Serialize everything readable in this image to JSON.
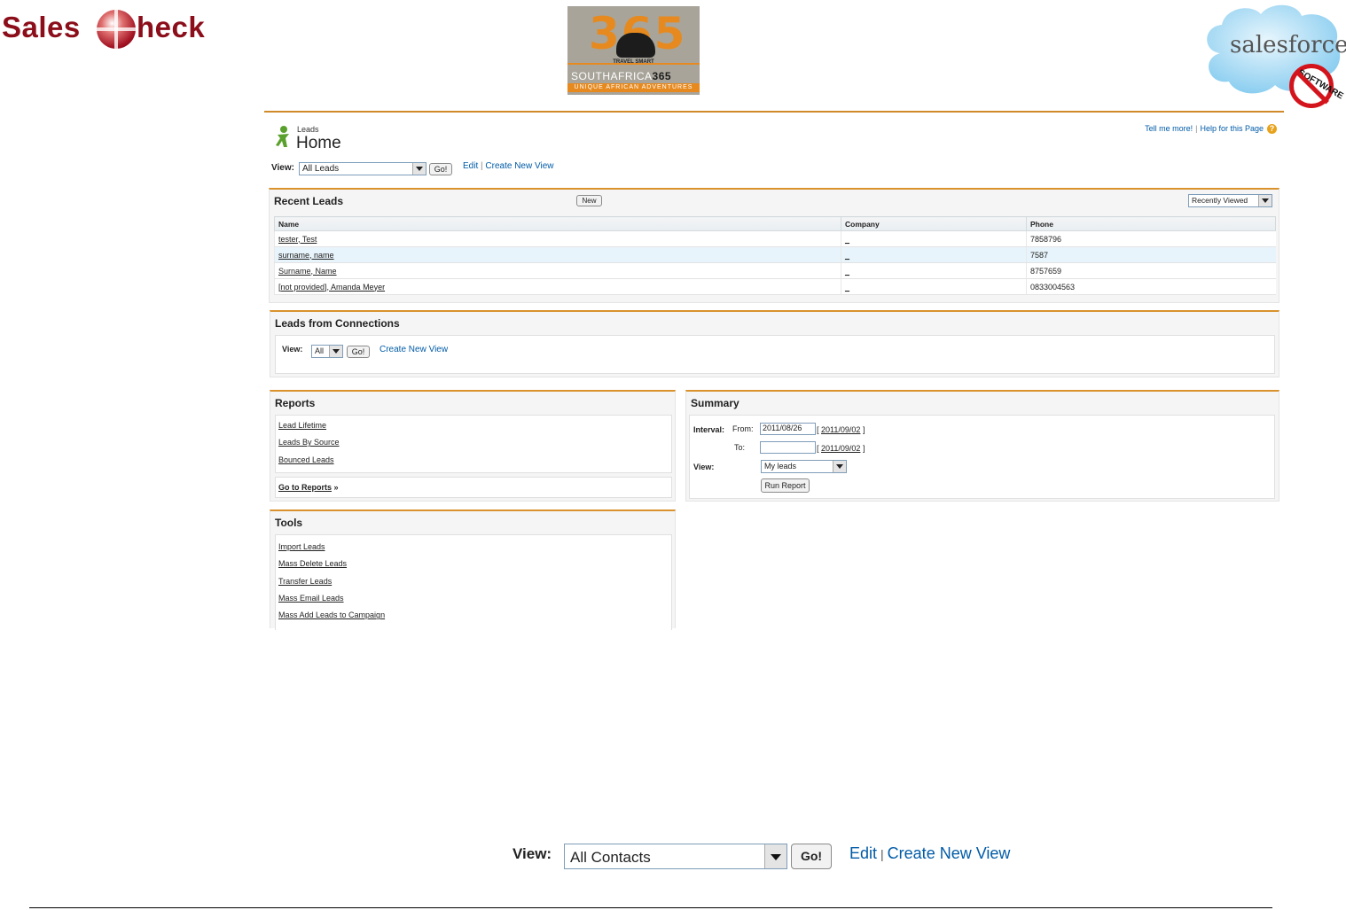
{
  "header": {
    "brand_left": {
      "text_before": "Sales",
      "text_after": "heck"
    },
    "brand_center": {
      "number": "365",
      "travel_smart": "TRAVEL SMART",
      "name_a": "SOUTHAFRICA",
      "name_b": "365",
      "tagline": "UNIQUE AFRICAN ADVENTURES"
    },
    "brand_right": {
      "word": "salesforce",
      "badge": "SOFTWARE"
    }
  },
  "page": {
    "object_label": "Leads",
    "title": "Home",
    "tell_me_more": "Tell me more!",
    "help_link": "Help for this Page",
    "help_icon": "?",
    "view_label": "View:",
    "view_selected": "All Leads",
    "go": "Go!",
    "edit": "Edit",
    "sep": "|",
    "create_new_view": "Create New View"
  },
  "recent_leads": {
    "title": "Recent Leads",
    "new_button": "New",
    "filter_selected": "Recently Viewed",
    "columns": [
      "Name",
      "Company",
      "Phone"
    ],
    "rows": [
      {
        "name": "tester, Test",
        "company": "_",
        "phone": "7858796"
      },
      {
        "name": "surname, name",
        "company": "_",
        "phone": "7587"
      },
      {
        "name": "Surname, Name",
        "company": "_",
        "phone": "8757659"
      },
      {
        "name": "[not provided], Amanda Meyer",
        "company": "_",
        "phone": "0833004563"
      }
    ]
  },
  "connections": {
    "title": "Leads from Connections",
    "view_label": "View:",
    "view_selected": "All",
    "go": "Go!",
    "create_new_view": "Create New View"
  },
  "reports": {
    "title": "Reports",
    "items": [
      "Lead Lifetime",
      "Leads By Source",
      "Bounced Leads"
    ],
    "go_to_reports": "Go to Reports",
    "arrow": "»"
  },
  "summary": {
    "title": "Summary",
    "interval_label": "Interval:",
    "from_label": "From:",
    "from_value": "2011/08/26",
    "from_link": "2011/09/02",
    "to_label": "To:",
    "to_value": "",
    "to_link": "2011/09/02",
    "bracket_open": "[",
    "bracket_close": "]",
    "view_label": "View:",
    "view_selected": "My leads",
    "run_report": "Run Report"
  },
  "tools": {
    "title": "Tools",
    "items": [
      "Import Leads",
      "Mass Delete Leads",
      "Transfer Leads",
      "Mass Email Leads",
      "Mass Add Leads to Campaign"
    ]
  },
  "zoomed_view": {
    "view_label": "View:",
    "view_selected": "All Contacts",
    "go": "Go!",
    "edit": "Edit",
    "sep": "|",
    "create_new_view": "Create New View"
  },
  "colors": {
    "accent": "#d9922c",
    "link": "#015ba7",
    "brand_red": "#8b0e1a"
  }
}
